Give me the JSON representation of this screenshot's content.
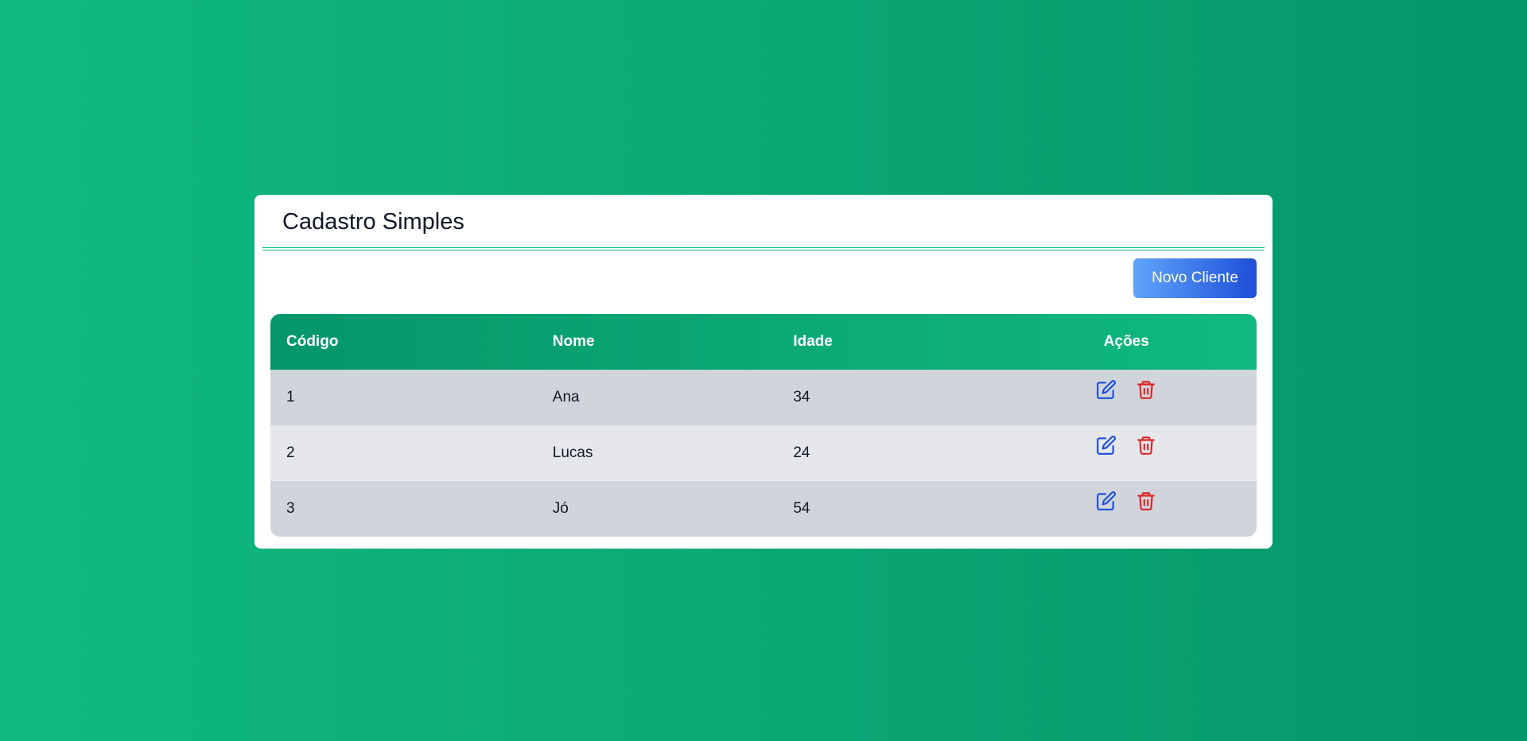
{
  "page": {
    "title": "Cadastro Simples"
  },
  "toolbar": {
    "new_button_label": "Novo Cliente"
  },
  "table": {
    "columns": [
      "Código",
      "Nome",
      "Idade",
      "Ações"
    ],
    "rows": [
      {
        "codigo": "1",
        "nome": "Ana",
        "idade": "34"
      },
      {
        "codigo": "2",
        "nome": "Lucas",
        "idade": "24"
      },
      {
        "codigo": "3",
        "nome": "Jó",
        "idade": "54"
      }
    ],
    "row_actions": [
      {
        "name": "edit-icon",
        "color": "#1d4ed8"
      },
      {
        "name": "trash-icon",
        "color": "#dc2626"
      }
    ]
  },
  "colors": {
    "background_start": "#10b981",
    "background_end": "#059669",
    "header_start": "#059669",
    "header_end": "#10b981",
    "button_start": "#60a5fa",
    "button_end": "#1d4ed8",
    "row_odd": "#d1d5db",
    "row_even": "#e5e7eb"
  }
}
